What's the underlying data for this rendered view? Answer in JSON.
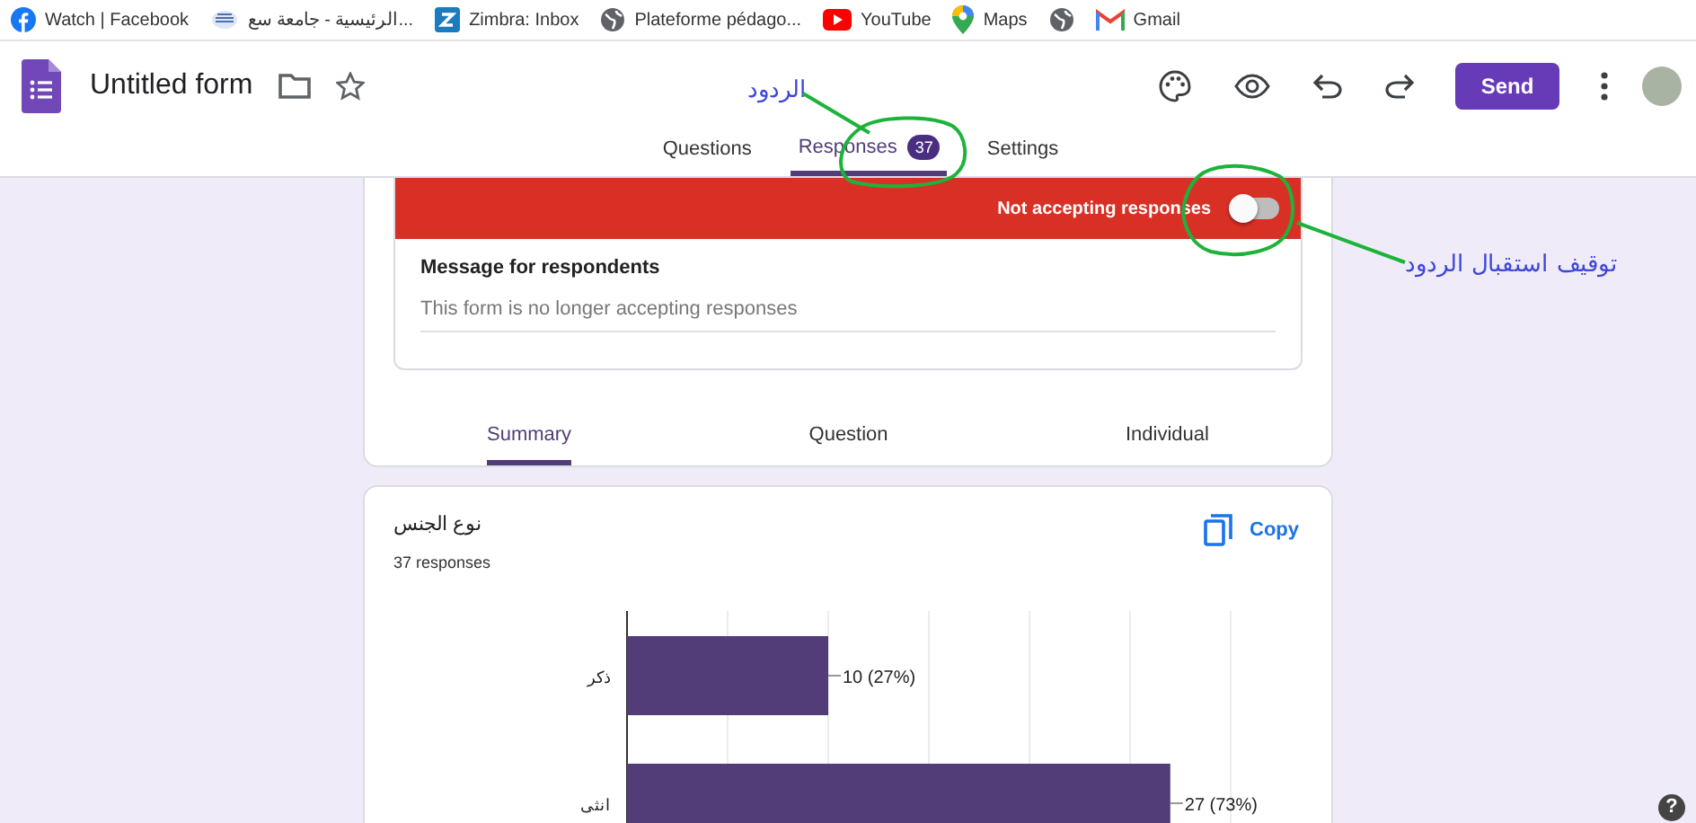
{
  "bookmarks": [
    {
      "label": "Watch | Facebook",
      "kind": "facebook"
    },
    {
      "label": "الرئيسية - جامعة سع...",
      "kind": "university"
    },
    {
      "label": "Zimbra: Inbox",
      "kind": "zimbra"
    },
    {
      "label": "Plateforme pédago...",
      "kind": "globe"
    },
    {
      "label": "YouTube",
      "kind": "youtube"
    },
    {
      "label": "Maps",
      "kind": "maps"
    },
    {
      "kind": "globe"
    },
    {
      "label": "Gmail",
      "kind": "gmail"
    }
  ],
  "header": {
    "title": "Untitled form",
    "send_button": "Send"
  },
  "tabs": [
    {
      "label": "Questions",
      "selected": false
    },
    {
      "label": "Responses",
      "selected": true,
      "badge": "37"
    },
    {
      "label": "Settings",
      "selected": false
    }
  ],
  "responses_banner": {
    "label": "Not accepting responses",
    "accepting": false
  },
  "message": {
    "label": "Message for respondents",
    "value": "This form is no longer accepting responses"
  },
  "view_tabs": [
    {
      "label": "Summary",
      "selected": true
    },
    {
      "label": "Question",
      "selected": false
    },
    {
      "label": "Individual",
      "selected": false
    }
  ],
  "question_card": {
    "title": "نوع الجنس",
    "count": "37 responses",
    "copy_button": "Copy",
    "chart_data": {
      "type": "bar",
      "orientation": "horizontal",
      "categories": [
        "ذكر",
        "انثى"
      ],
      "values": [
        10,
        27
      ],
      "xlim": [
        0,
        30
      ],
      "value_labels": [
        "10 (27%)",
        "27 (73%)"
      ]
    }
  },
  "annotations": [
    {
      "text": "الردود"
    },
    {
      "text": "توقيف استقبال الردود"
    }
  ],
  "help_button": "?"
}
